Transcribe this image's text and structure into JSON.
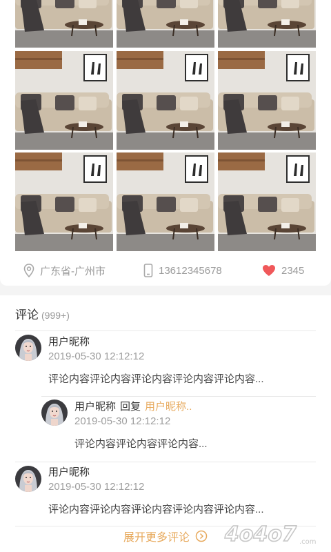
{
  "post": {
    "photos": [
      {
        "alt": "living-room-sofa-photo"
      },
      {
        "alt": "living-room-sofa-photo"
      },
      {
        "alt": "living-room-sofa-photo"
      },
      {
        "alt": "living-room-sofa-photo"
      },
      {
        "alt": "living-room-sofa-photo"
      },
      {
        "alt": "living-room-sofa-photo"
      },
      {
        "alt": "living-room-sofa-photo"
      },
      {
        "alt": "living-room-sofa-photo"
      },
      {
        "alt": "living-room-sofa-photo"
      }
    ],
    "location": "广东省-广州市",
    "phone": "13612345678",
    "likes": "2345",
    "location_icon": "location-pin-icon",
    "phone_icon": "phone-icon",
    "like_icon": "heart-icon"
  },
  "comments": {
    "title": "评论",
    "count": "(999+)",
    "items": [
      {
        "name": "用户昵称",
        "time": "2019-05-30 12:12:12",
        "text": "评论内容评论内容评论内容评论内容评论内容..."
      },
      {
        "name": "用户昵称",
        "reply_word": "回复",
        "reply_to": "用户昵称..",
        "time": "2019-05-30 12:12:12",
        "text": "评论内容评论内容评论内容..."
      },
      {
        "name": "用户昵称",
        "time": "2019-05-30 12:12:12",
        "text": "评论内容评论内容评论内容评论内容评论内容..."
      }
    ],
    "expand_label": "展开更多评论"
  },
  "watermark": "4o4o7.com",
  "colors": {
    "accent": "#e7a95c",
    "heart": "#f0585a",
    "muted": "#9a9a9a"
  }
}
